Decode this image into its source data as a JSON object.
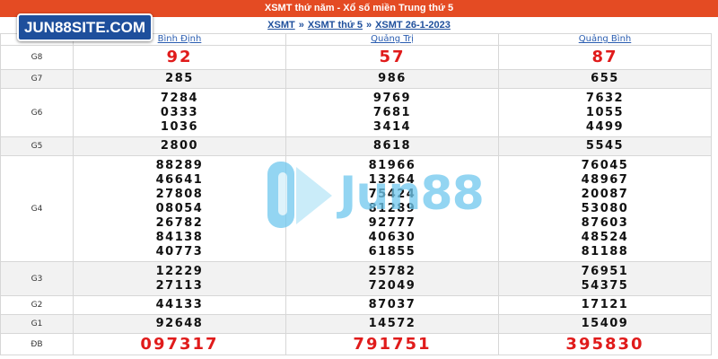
{
  "header": {
    "title": "XSMT thứ năm - Xổ số miền Trung thứ 5",
    "breadcrumbs": [
      "XSMT",
      "XSMT thứ 5",
      "XSMT 26-1-2023"
    ],
    "separator": "»"
  },
  "brand": {
    "label": "JUN88SITE.COM"
  },
  "watermark": {
    "text": "Jun88"
  },
  "provinces": [
    "Bình Định",
    "Quảng Trị",
    "Quảng Bình"
  ],
  "rows": [
    {
      "label": "G8",
      "values": [
        [
          "92"
        ],
        [
          "57"
        ],
        [
          "87"
        ]
      ]
    },
    {
      "label": "G7",
      "values": [
        [
          "285"
        ],
        [
          "986"
        ],
        [
          "655"
        ]
      ]
    },
    {
      "label": "G6",
      "values": [
        [
          "7284",
          "0333",
          "1036"
        ],
        [
          "9769",
          "7681",
          "3414"
        ],
        [
          "7632",
          "1055",
          "4499"
        ]
      ]
    },
    {
      "label": "G5",
      "values": [
        [
          "2800"
        ],
        [
          "8618"
        ],
        [
          "5545"
        ]
      ]
    },
    {
      "label": "G4",
      "values": [
        [
          "88289",
          "46641",
          "27808",
          "08054",
          "26782",
          "84138",
          "40773"
        ],
        [
          "81966",
          "13264",
          "75424",
          "81289",
          "92777",
          "40630",
          "61855"
        ],
        [
          "76045",
          "48967",
          "20087",
          "53080",
          "87603",
          "48524",
          "81188"
        ]
      ]
    },
    {
      "label": "G3",
      "values": [
        [
          "12229",
          "27113"
        ],
        [
          "25782",
          "72049"
        ],
        [
          "76951",
          "54375"
        ]
      ]
    },
    {
      "label": "G2",
      "values": [
        [
          "44133"
        ],
        [
          "87037"
        ],
        [
          "17121"
        ]
      ]
    },
    {
      "label": "G1",
      "values": [
        [
          "92648"
        ],
        [
          "14572"
        ],
        [
          "15409"
        ]
      ]
    },
    {
      "label": "ĐB",
      "values": [
        [
          "097317"
        ],
        [
          "791751"
        ],
        [
          "395830"
        ]
      ]
    }
  ],
  "colors": {
    "header_bg": "#e44b23",
    "link": "#1e4f9c",
    "highlight": "#e01b1b",
    "row_alt": "#f2f2f2"
  }
}
